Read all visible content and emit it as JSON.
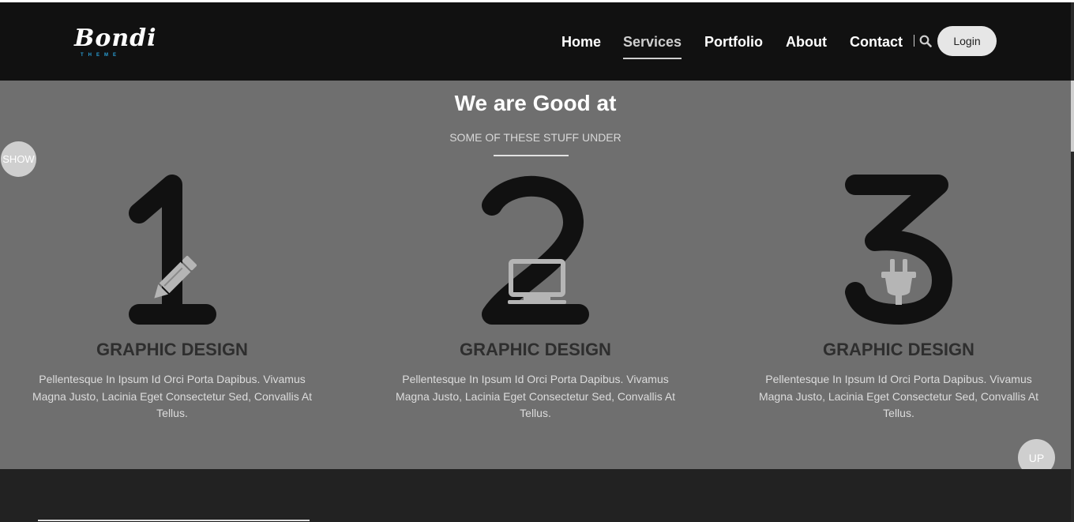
{
  "header": {
    "logo_text": "Bondi",
    "logo_sub": "THEME",
    "nav": [
      "Home",
      "Services",
      "Portfolio",
      "About",
      "Contact"
    ],
    "active_nav": "Services",
    "login_label": "Login"
  },
  "section": {
    "title": "We are Good at",
    "subtitle": "SOME OF THESE STUFF UNDER"
  },
  "floating": {
    "show_label": "SHOW",
    "up_label": "UP"
  },
  "services": [
    {
      "number": "1",
      "icon": "pencil-icon",
      "title": "GRAPHIC DESIGN",
      "text": "Pellentesque In Ipsum Id Orci Porta Dapibus. Vivamus Magna Justo, Lacinia Eget Consectetur Sed, Convallis At Tellus."
    },
    {
      "number": "2",
      "icon": "monitor-icon",
      "title": "GRAPHIC DESIGN",
      "text": "Pellentesque In Ipsum Id Orci Porta Dapibus. Vivamus Magna Justo, Lacinia Eget Consectetur Sed, Convallis At Tellus."
    },
    {
      "number": "3",
      "icon": "plug-icon",
      "title": "GRAPHIC DESIGN",
      "text": "Pellentesque In Ipsum Id Orci Porta Dapibus. Vivamus Magna Justo, Lacinia Eget Consectetur Sed, Convallis At Tellus."
    }
  ],
  "colors": {
    "header_bg": "#111111",
    "section_bg": "#6f6f6f",
    "footer_bg": "#222222",
    "accent": "#2a9fd6"
  }
}
